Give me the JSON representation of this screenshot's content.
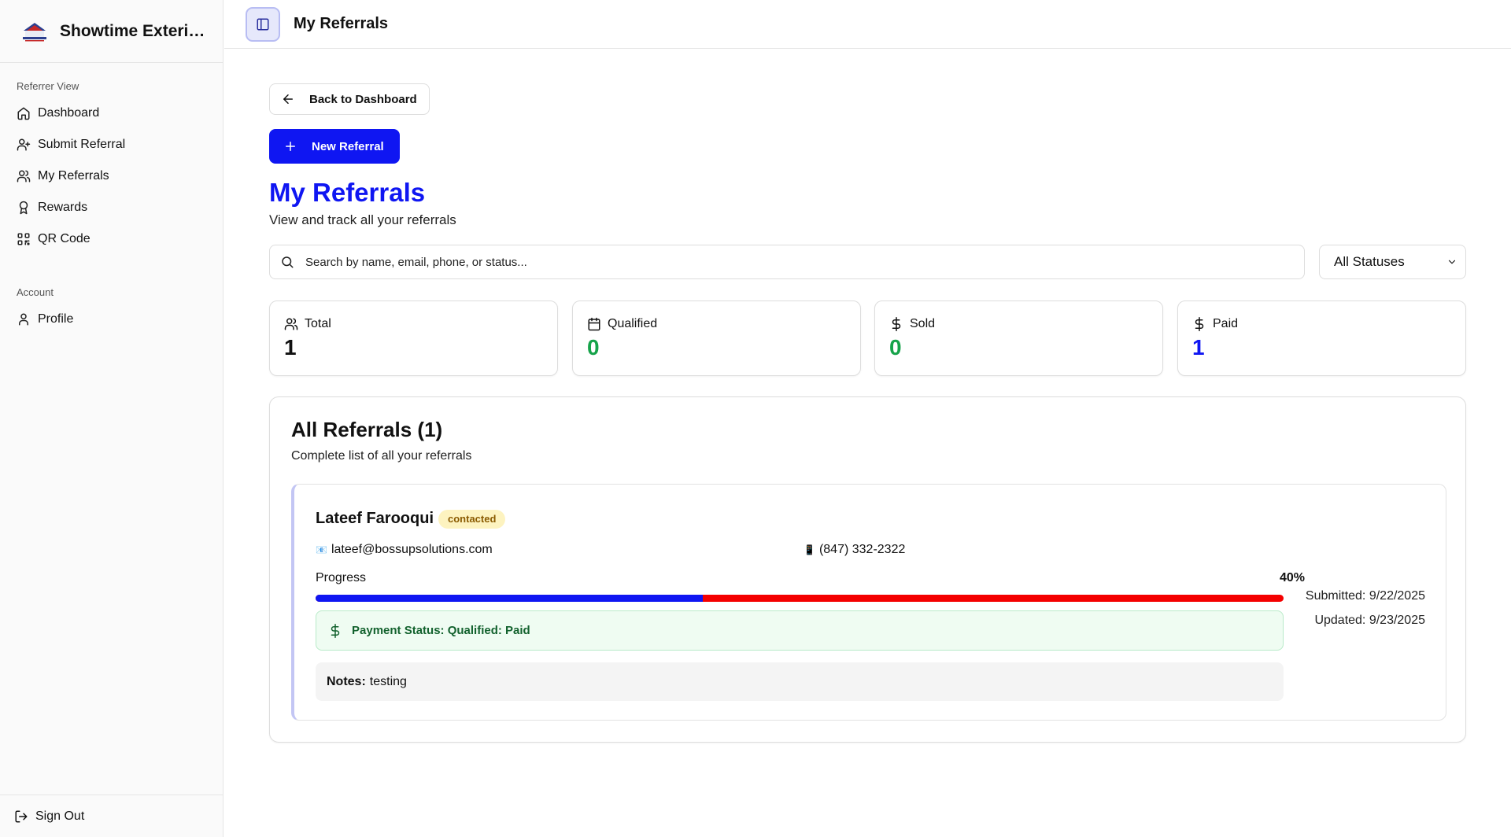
{
  "brand": {
    "name": "Showtime Exterio..."
  },
  "sidebar": {
    "groups": [
      {
        "label": "Referrer View",
        "items": [
          {
            "label": "Dashboard",
            "icon": "home-icon"
          },
          {
            "label": "Submit Referral",
            "icon": "user-plus-icon"
          },
          {
            "label": "My Referrals",
            "icon": "users-icon"
          },
          {
            "label": "Rewards",
            "icon": "award-icon"
          },
          {
            "label": "QR Code",
            "icon": "qr-code-icon"
          }
        ]
      },
      {
        "label": "Account",
        "items": [
          {
            "label": "Profile",
            "icon": "user-icon"
          }
        ]
      }
    ],
    "signout": "Sign Out"
  },
  "header": {
    "title": "My Referrals"
  },
  "main": {
    "back_label": "Back to Dashboard",
    "new_label": "New Referral",
    "title": "My Referrals",
    "subtitle": "View and track all your referrals",
    "search_placeholder": "Search by name, email, phone, or status...",
    "status_filter": "All Statuses"
  },
  "stats": [
    {
      "label": "Total",
      "value": "1",
      "icon": "users-icon",
      "color": "#111111"
    },
    {
      "label": "Qualified",
      "value": "0",
      "icon": "calendar-icon",
      "color": "#16a34a"
    },
    {
      "label": "Sold",
      "value": "0",
      "icon": "dollar-icon",
      "color": "#16a34a"
    },
    {
      "label": "Paid",
      "value": "1",
      "icon": "dollar-icon",
      "color": "#0f16f2"
    }
  ],
  "list": {
    "title": "All Referrals (1)",
    "subtitle": "Complete list of all your referrals"
  },
  "referral": {
    "name": "Lateef Farooqui",
    "status": "contacted",
    "email_emoji": "📧",
    "email": "lateef@bossupsolutions.com",
    "phone_emoji": "📱",
    "phone": "(847) 332-2322",
    "progress_label": "Progress",
    "progress_text": "40%",
    "progress_fraction": 0.4,
    "payment_status": "Payment Status: Qualified: Paid",
    "notes_label": "Notes:",
    "notes": "testing",
    "submitted": "Submitted: 9/22/2025",
    "updated": "Updated: 9/23/2025"
  },
  "colors": {
    "accent": "#0f16f2",
    "progress_remaining": "#f40000",
    "success": "#16a34a"
  }
}
